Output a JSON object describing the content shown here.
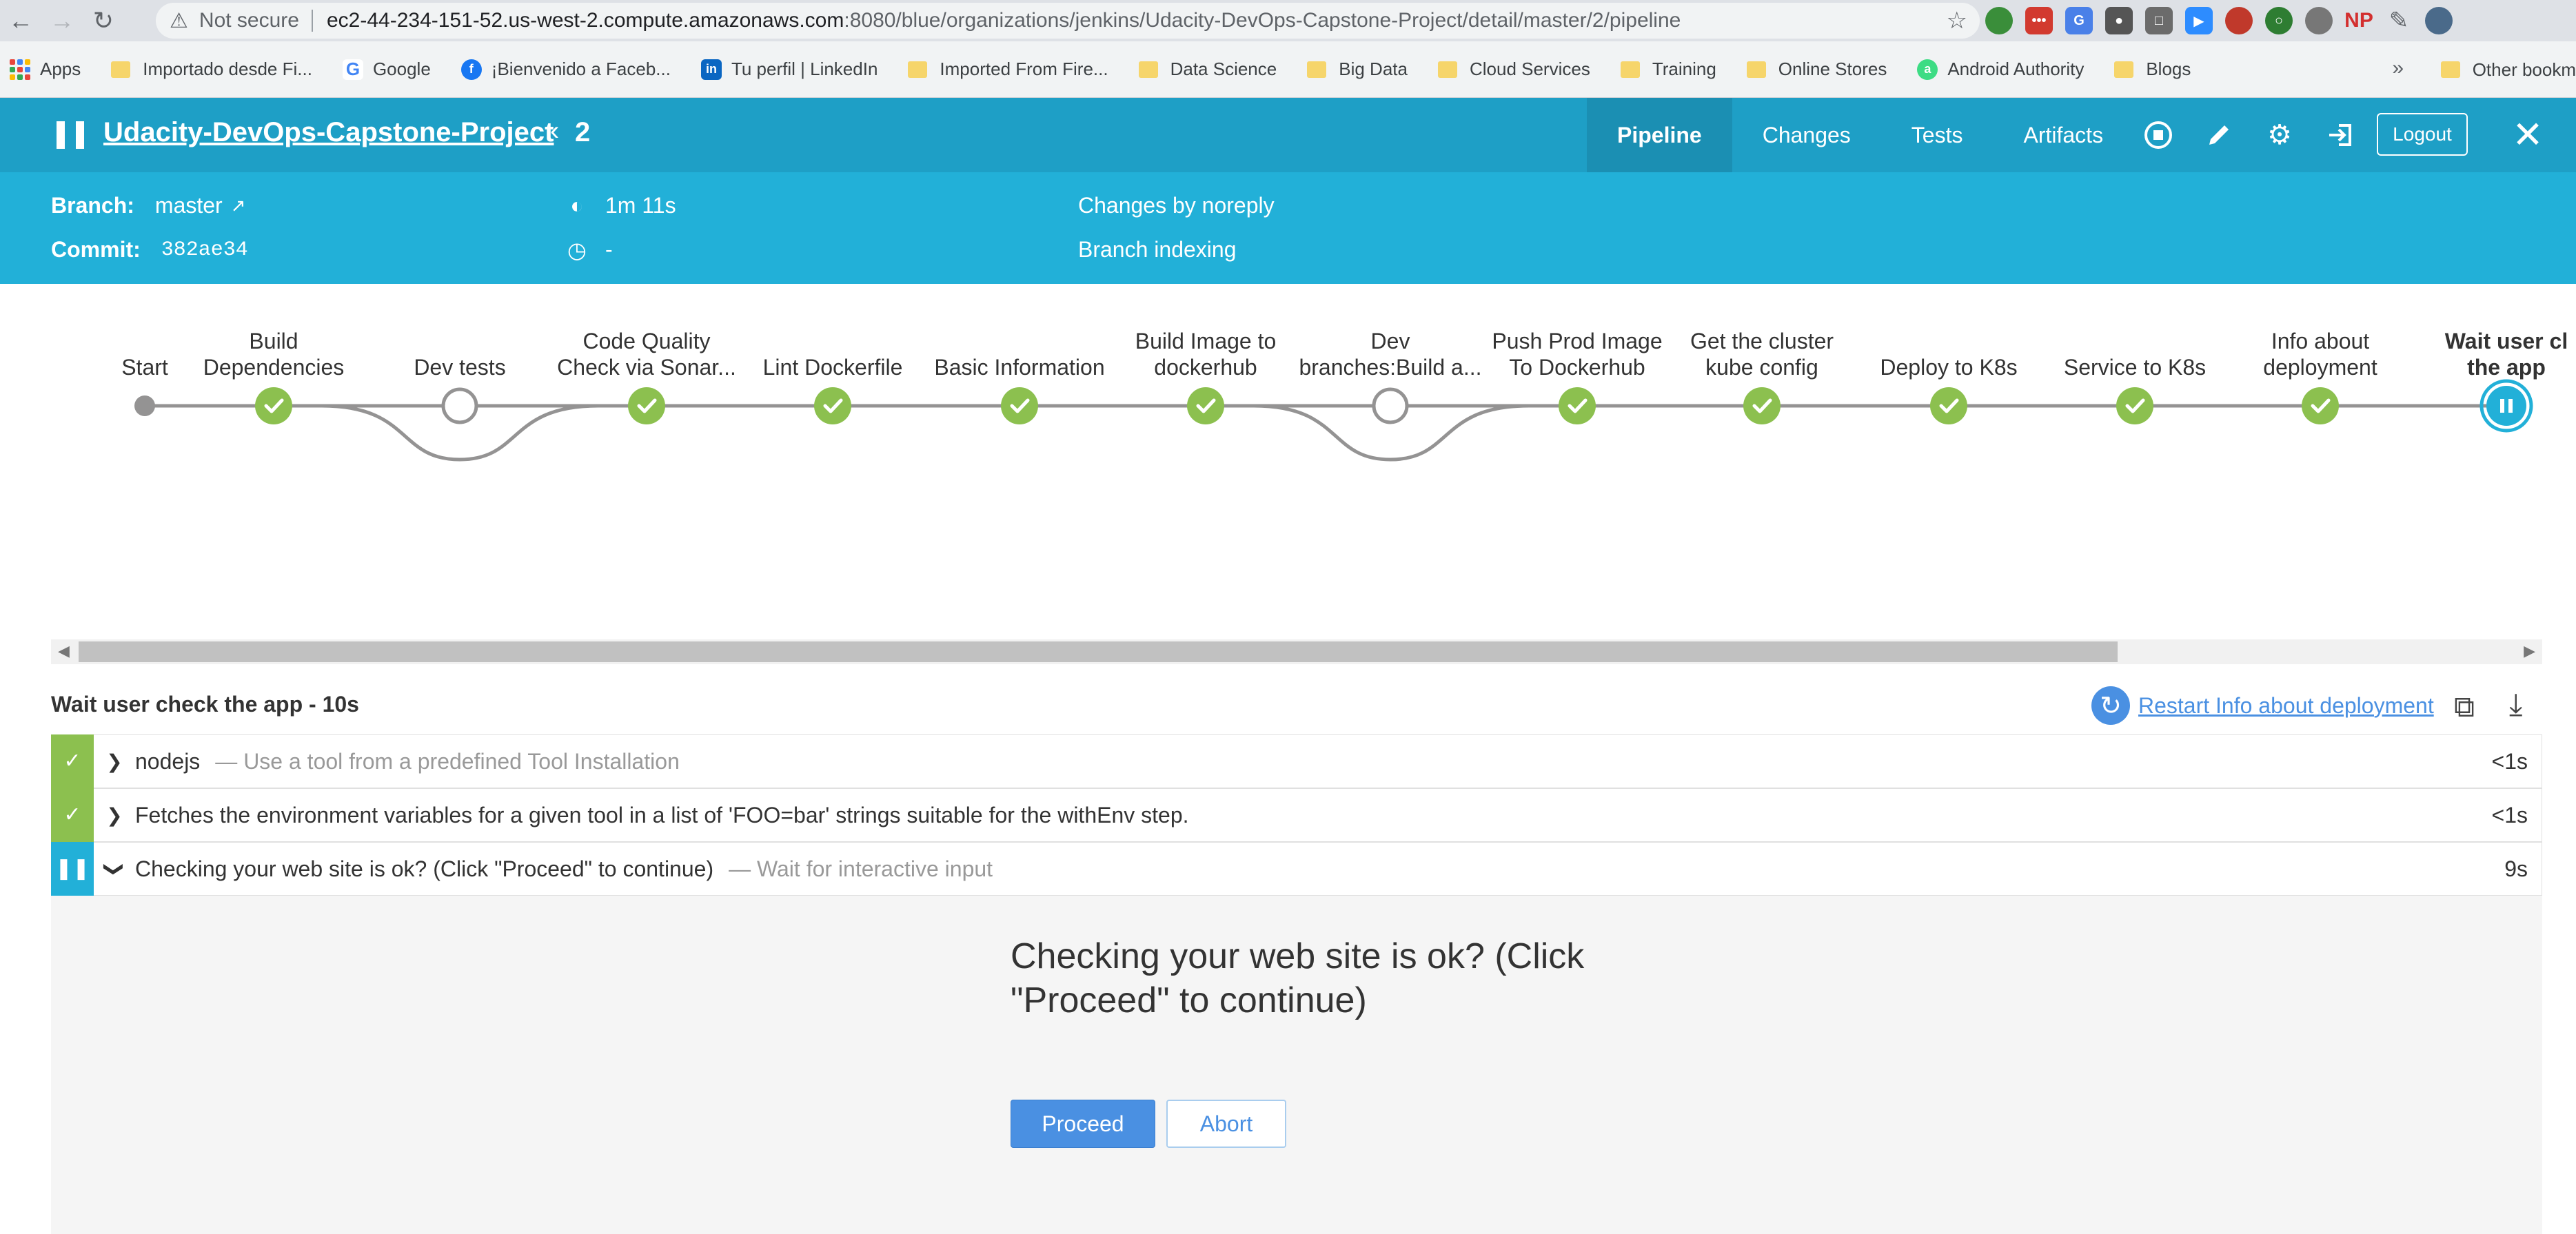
{
  "browser": {
    "not_secure": "Not secure",
    "url_host": "ec2-44-234-151-52.us-west-2.compute.amazonaws.com",
    "url_rest": ":8080/blue/organizations/jenkins/Udacity-DevOps-Capstone-Project/detail/master/2/pipeline",
    "bookmarks": [
      "Apps",
      "Importado desde Fi...",
      "Google",
      "¡Bienvenido a Faceb...",
      "Tu perfil | LinkedIn",
      "Imported From Fire...",
      "Data Science",
      "Big Data",
      "Cloud Services",
      "Training",
      "Online Stores",
      "Android Authority",
      "Blogs"
    ],
    "more": "»",
    "other_bookmarks": "Other bookm",
    "extension_np": "NP"
  },
  "header": {
    "project": "Udacity-DevOps-Capstone-Project",
    "run": "2",
    "tabs": [
      "Pipeline",
      "Changes",
      "Tests",
      "Artifacts"
    ],
    "logout": "Logout"
  },
  "run_info": {
    "branch_label": "Branch:",
    "branch": "master",
    "commit_label": "Commit:",
    "commit": "382ae34",
    "duration": "1m 11s",
    "ended": "-",
    "changes": "Changes by noreply",
    "cause": "Branch indexing"
  },
  "pipeline": {
    "stages": [
      {
        "line1": "",
        "line2": "Start",
        "status": "start"
      },
      {
        "line1": "Build",
        "line2": "Dependencies",
        "status": "success"
      },
      {
        "line1": "",
        "line2": "Dev tests",
        "status": "skipped"
      },
      {
        "line1": "Code Quality",
        "line2": "Check via Sonar...",
        "status": "success"
      },
      {
        "line1": "",
        "line2": "Lint Dockerfile",
        "status": "success"
      },
      {
        "line1": "",
        "line2": "Basic Information",
        "status": "success"
      },
      {
        "line1": "Build Image to",
        "line2": "dockerhub",
        "status": "success"
      },
      {
        "line1": "Dev",
        "line2": "branches:Build a...",
        "status": "skipped"
      },
      {
        "line1": "Push Prod Image",
        "line2": "To Dockerhub",
        "status": "success"
      },
      {
        "line1": "Get the cluster",
        "line2": "kube config",
        "status": "success"
      },
      {
        "line1": "",
        "line2": "Deploy to K8s",
        "status": "success"
      },
      {
        "line1": "",
        "line2": "Service to K8s",
        "status": "success"
      },
      {
        "line1": "Info about",
        "line2": "deployment",
        "status": "success"
      },
      {
        "line1": "Wait user cl",
        "line2": "the app",
        "status": "paused"
      }
    ]
  },
  "steps": {
    "title": "Wait user check the app - 10s",
    "restart": "Restart Info about deployment",
    "rows": [
      {
        "name": "nodejs",
        "desc": "— Use a tool from a predefined Tool Installation",
        "duration": "<1s",
        "status": "success"
      },
      {
        "name": "Fetches the environment variables for a given tool in a list of 'FOO=bar' strings suitable for the withEnv step.",
        "desc": "",
        "duration": "<1s",
        "status": "success"
      },
      {
        "name": "Checking your web site is ok? (Click \"Proceed\" to continue)",
        "desc": "— Wait for interactive input",
        "duration": "9s",
        "status": "paused"
      }
    ]
  },
  "input": {
    "message": "Checking your web site is ok? (Click \"Proceed\" to continue)",
    "proceed": "Proceed",
    "abort": "Abort"
  },
  "colors": {
    "header": "#1e9fc6",
    "run_info": "#22b0d8",
    "success": "#8cc04f",
    "paused": "#22b0d8",
    "link": "#4a90e2"
  }
}
